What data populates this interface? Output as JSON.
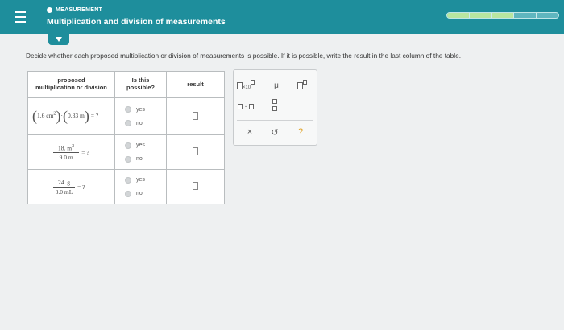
{
  "header": {
    "topic": "MEASUREMENT",
    "title": "Multiplication and division of measurements",
    "progress_filled_segments": 3,
    "progress_total_segments": 5
  },
  "instructions": "Decide whether each proposed multiplication or division of measurements is possible. If it is possible, write the result in the last column of the table.",
  "table": {
    "headers": {
      "proposed_line1": "proposed",
      "proposed_line2": "multiplication or division",
      "possible_line1": "Is this",
      "possible_line2": "possible?",
      "result": "result"
    },
    "rows": [
      {
        "value1": "1.6",
        "unit1": "cm",
        "exp1": "2",
        "value2": "0.33",
        "unit2": "m",
        "tail": "= ?"
      },
      {
        "num": "18. m",
        "num_exp": "3",
        "den": "9.0 m",
        "tail": "= ?"
      },
      {
        "num": "24. g",
        "den": "3.0 mL",
        "tail": "= ?"
      }
    ],
    "yes_label": "yes",
    "no_label": "no"
  },
  "palette": {
    "mu": "μ",
    "times_dot": "·",
    "clear": "×",
    "undo": "↺",
    "help": "?"
  },
  "colors": {
    "header": "#1e8e9c",
    "progress_fill": "#b8e6a0",
    "help": "#e0a020"
  }
}
